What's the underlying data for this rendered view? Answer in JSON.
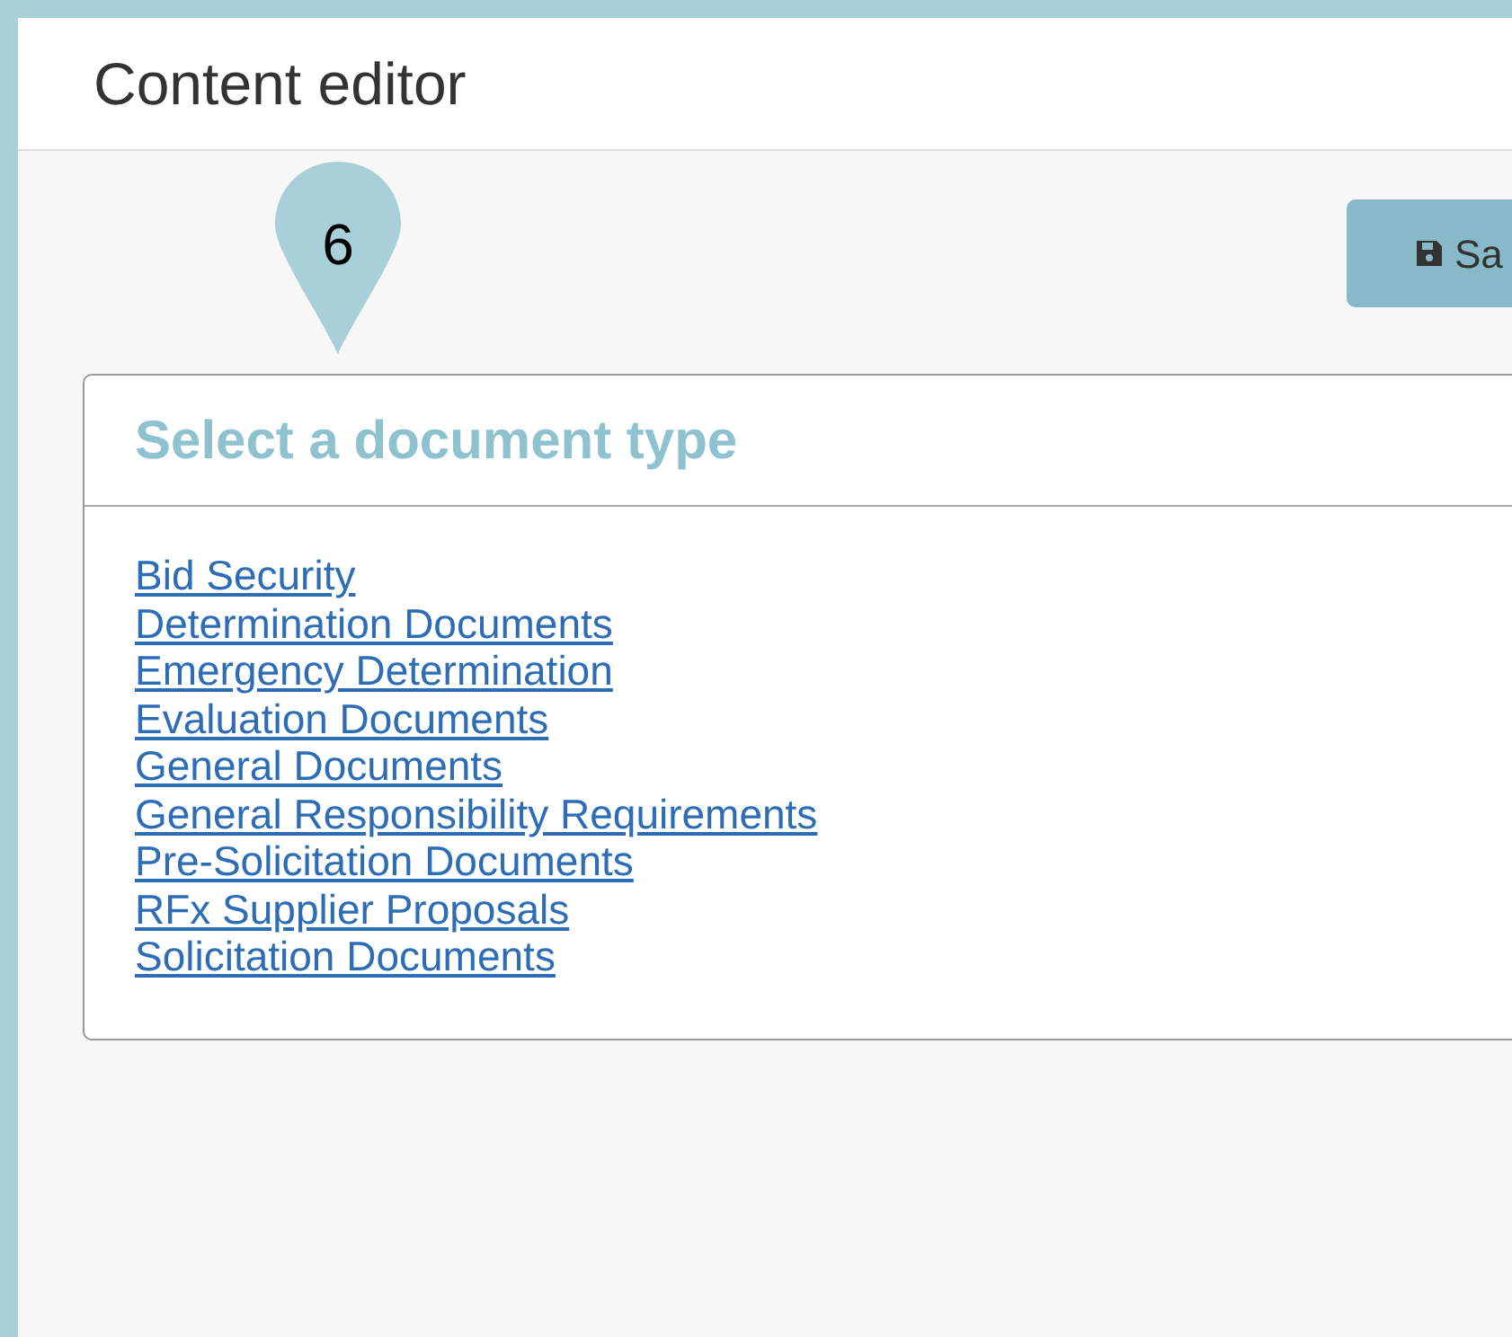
{
  "header": {
    "title": "Content editor"
  },
  "marker": {
    "label": "6"
  },
  "save_button": {
    "label": "Sa"
  },
  "card": {
    "title": "Select a document type",
    "links": [
      "Bid Security",
      "Determination Documents",
      "Emergency Determination",
      "Evaluation Documents",
      "General Documents",
      "General Responsibility Requirements",
      "Pre-Solicitation Documents",
      "RFx Supplier Proposals",
      "Solicitation Documents"
    ]
  }
}
